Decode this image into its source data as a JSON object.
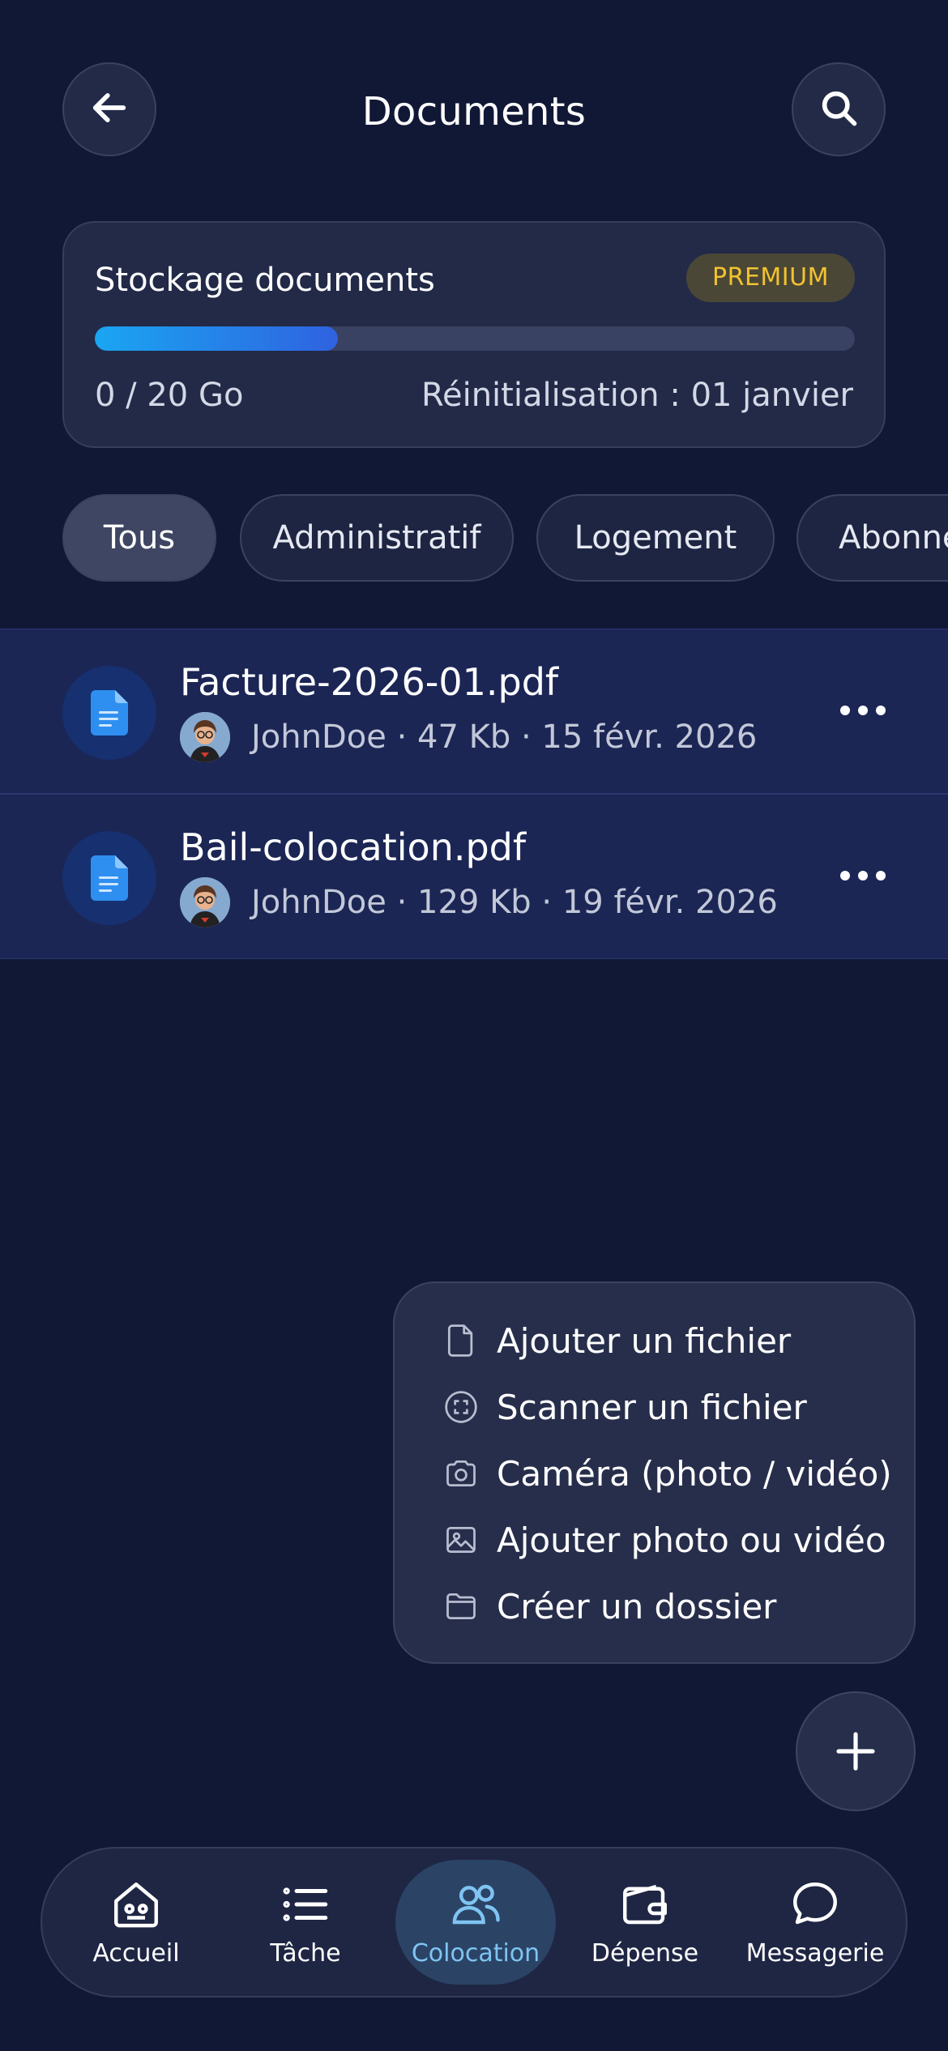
{
  "header": {
    "title": "Documents",
    "back_icon": "arrow-left-icon",
    "search_icon": "search-icon"
  },
  "storage": {
    "title": "Stockage documents",
    "badge": "PREMIUM",
    "used_label": "0 / 20 Go",
    "reset_label": "Réinitialisation : 01 janvier",
    "progress_fraction": 0.32,
    "progress_colors": [
      "#1aa6f2",
      "#2f62e0"
    ]
  },
  "filters": {
    "chips": [
      {
        "label": "Tous",
        "active": true
      },
      {
        "label": "Administratif",
        "active": false
      },
      {
        "label": "Logement",
        "active": false
      },
      {
        "label": "Abonnements",
        "active": false
      }
    ]
  },
  "documents": [
    {
      "name": "Facture-2026-01.pdf",
      "meta": "JohnDoe · 47 Kb · 15 févr. 2026",
      "icon": "document-icon"
    },
    {
      "name": "Bail-colocation.pdf",
      "meta": "JohnDoe · 129 Kb · 19 févr. 2026",
      "icon": "document-icon"
    }
  ],
  "action_menu": {
    "items": [
      {
        "label": "Ajouter un fichier",
        "icon": "file-icon"
      },
      {
        "label": "Scanner un fichier",
        "icon": "scan-icon"
      },
      {
        "label": "Caméra (photo / vidéo)",
        "icon": "camera-icon"
      },
      {
        "label": "Ajouter photo ou vidéo",
        "icon": "image-icon"
      },
      {
        "label": "Créer un dossier",
        "icon": "folder-icon"
      }
    ]
  },
  "fab": {
    "icon": "plus-icon"
  },
  "bottom_nav": {
    "items": [
      {
        "label": "Accueil",
        "icon": "home-icon",
        "active": false
      },
      {
        "label": "Tâche",
        "icon": "list-icon",
        "active": false
      },
      {
        "label": "Colocation",
        "icon": "users-icon",
        "active": true
      },
      {
        "label": "Dépense",
        "icon": "wallet-icon",
        "active": false
      },
      {
        "label": "Messagerie",
        "icon": "chat-icon",
        "active": false
      }
    ]
  },
  "colors": {
    "background": "#111836",
    "accent": "#1aa6f2",
    "premium": "#f2c230",
    "active_nav": "#7fc4f2"
  }
}
